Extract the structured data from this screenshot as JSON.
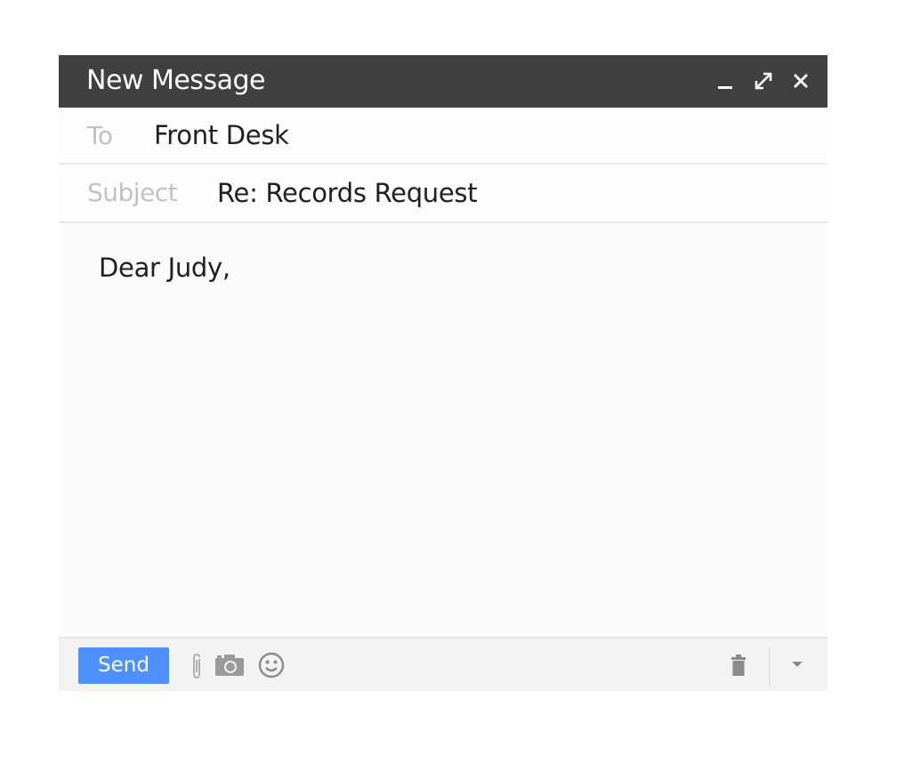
{
  "window": {
    "title": "New Message",
    "minimize_icon": "minimize-icon",
    "expand_icon": "expand-icon",
    "close_icon": "close-icon"
  },
  "to": {
    "label": "To",
    "value": "Front Desk"
  },
  "subject": {
    "label": "Subject",
    "value": "Re: Records Request"
  },
  "body": {
    "text": "Dear Judy,"
  },
  "toolbar": {
    "send_label": "Send",
    "icons": [
      "paperclip-icon",
      "camera-icon",
      "smiley-icon",
      "trash-icon",
      "dropdown-arrow-icon"
    ]
  },
  "colors": {
    "titlebar_bg": "#404040",
    "send_button": "#4d90fe",
    "label_gray": "#c2c2c2"
  }
}
